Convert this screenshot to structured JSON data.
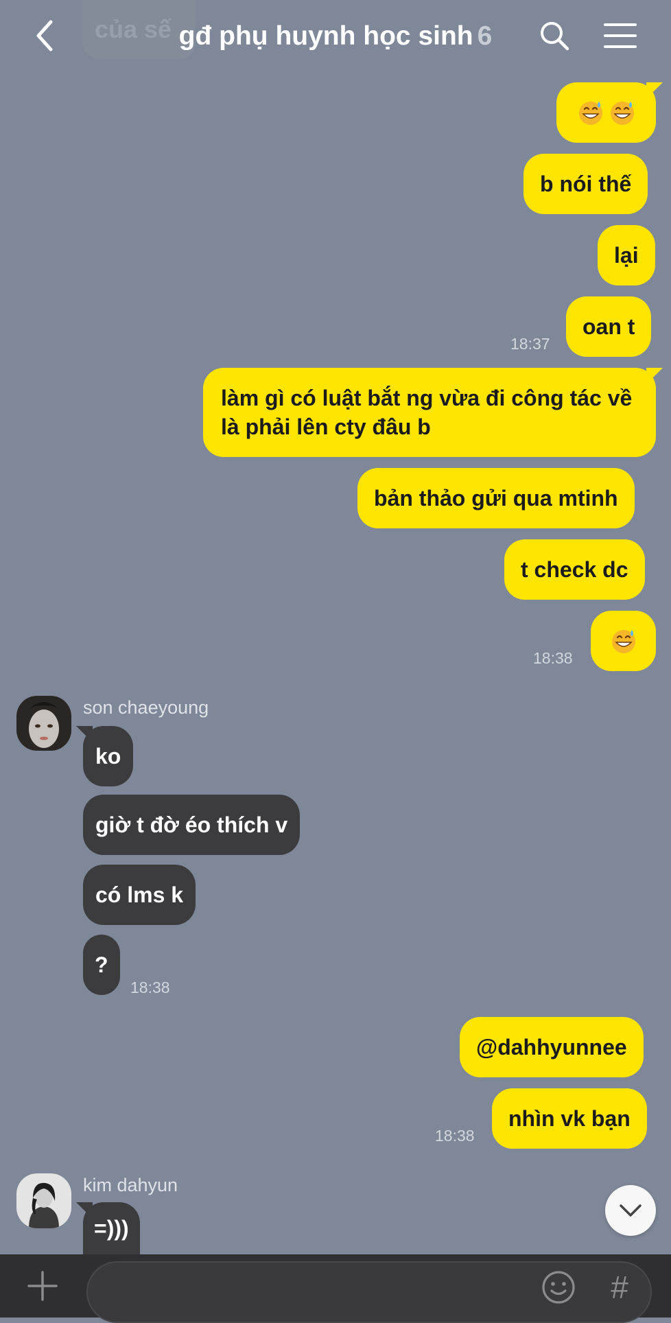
{
  "header": {
    "ghost_text": "của sế",
    "title": "gđ phụ huynh học sinh",
    "member_count": "6",
    "back_icon": "chevron-left-icon",
    "search_icon": "search-icon",
    "menu_icon": "hamburger-menu-icon"
  },
  "messages": [
    {
      "id": "m1",
      "text": "",
      "emoji": [
        "grinning-sweat-emoji",
        "grinning-sweat-emoji"
      ]
    },
    {
      "id": "m2",
      "text": "b nói thế"
    },
    {
      "id": "m3",
      "text": "lại"
    },
    {
      "id": "m4",
      "text": "oan t",
      "time": "18:37"
    },
    {
      "id": "m5",
      "text": "làm gì có luật bắt ng vừa đi công tác về là phải lên cty đâu b"
    },
    {
      "id": "m6",
      "text": "bản thảo gửi qua mtinh"
    },
    {
      "id": "m7",
      "text": "t check dc"
    },
    {
      "id": "m8",
      "text": "",
      "emoji": [
        "grinning-sweat-emoji"
      ],
      "time": "18:38"
    },
    {
      "id": "m9",
      "sender": "son chaeyoung",
      "text": "ko"
    },
    {
      "id": "m10",
      "text": "giờ t đờ éo thích v"
    },
    {
      "id": "m11",
      "text": "có lms k"
    },
    {
      "id": "m12",
      "text": "?",
      "time": "18:38"
    },
    {
      "id": "m13",
      "text": "@dahhyunnee"
    },
    {
      "id": "m14",
      "text": "nhìn vk bạn",
      "time": "18:38"
    },
    {
      "id": "m15",
      "sender": "kim dahyun",
      "text": "=)))"
    }
  ],
  "scroll_button": {
    "icon": "chevron-down-icon"
  },
  "input_bar": {
    "plus_icon": "plus-icon",
    "placeholder": "",
    "emoji_icon": "smiley-icon",
    "hash_label": "#"
  },
  "colors": {
    "background": "#7f8898",
    "outgoing_bubble": "#fee500",
    "incoming_bubble": "#3c3c3f",
    "input_bar": "#2f2f31"
  }
}
